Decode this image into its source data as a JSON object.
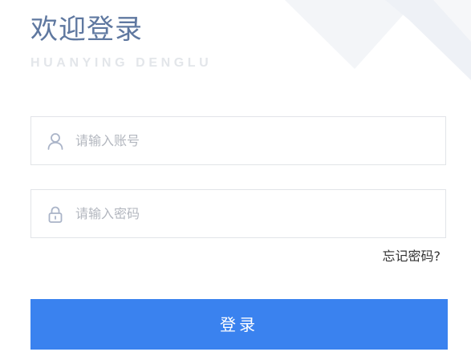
{
  "header": {
    "title": "欢迎登录",
    "subtitle": "HUANYING DENGLU"
  },
  "form": {
    "account": {
      "placeholder": "请输入账号",
      "value": "",
      "icon": "user-icon"
    },
    "password": {
      "placeholder": "请输入密码",
      "value": "",
      "icon": "lock-icon"
    },
    "forgot_label": "忘记密码?",
    "login_label": "登录"
  },
  "colors": {
    "title": "#5f78a0",
    "subtitle": "#e3e6ea",
    "border": "#e2e4e8",
    "icon": "#aab4c8",
    "primary": "#3a82ef",
    "decor": "#f1f3f7"
  }
}
